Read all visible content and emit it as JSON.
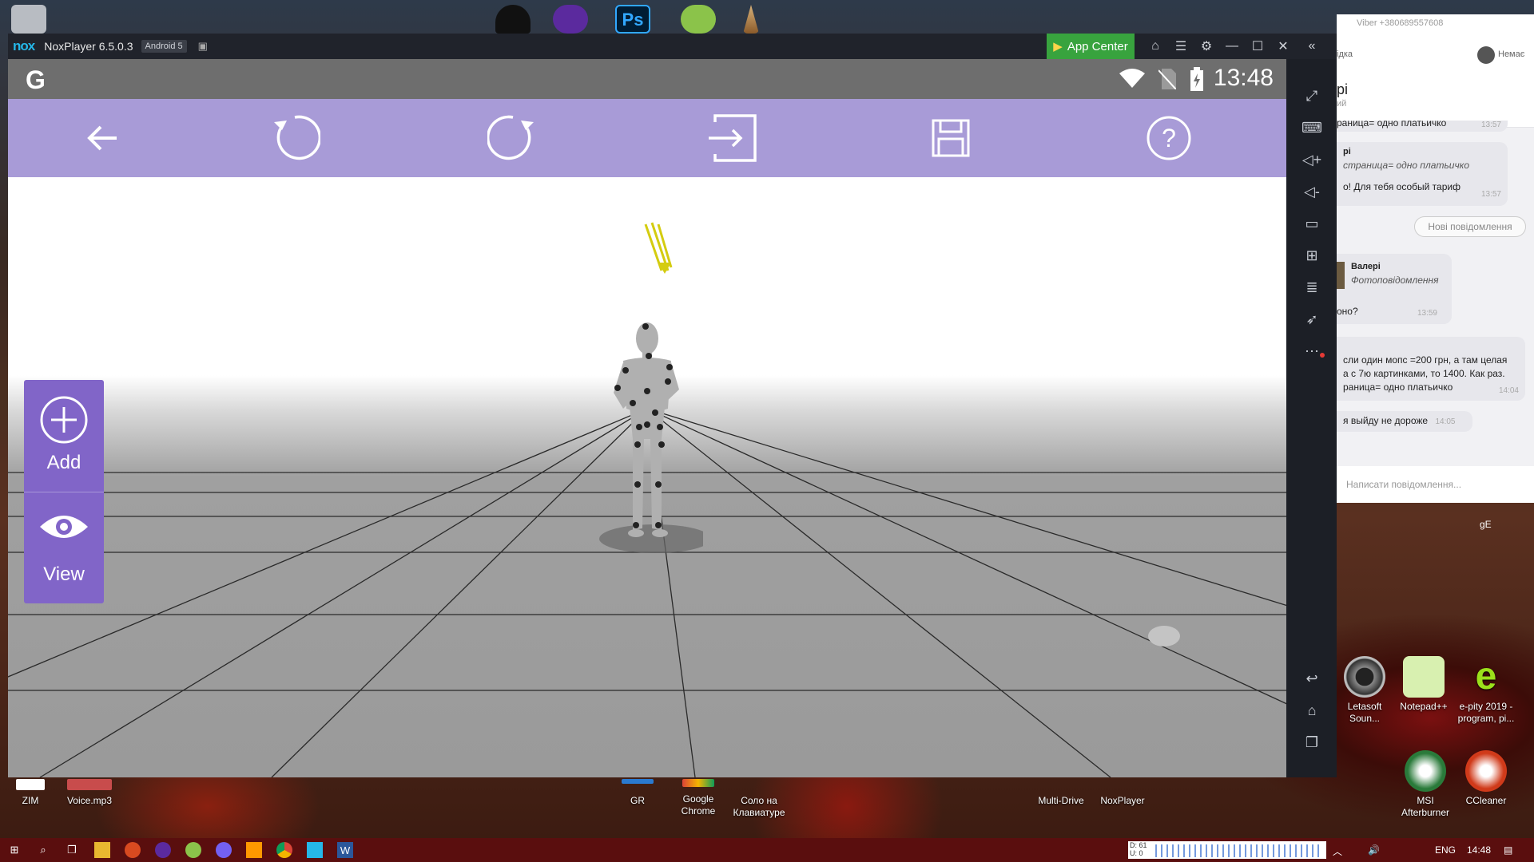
{
  "desktop": {
    "top_icons": [
      "trash-icon",
      "inkscape-icon",
      "tor-icon",
      "photoshop-icon",
      "lime-icon",
      "pencil-icon"
    ],
    "icons": [
      {
        "name": "desktop-icon-zim",
        "label": "ZIM"
      },
      {
        "name": "desktop-icon-voice",
        "label": "Voice.mp3"
      },
      {
        "name": "desktop-icon-gr",
        "label": "GR"
      },
      {
        "name": "desktop-icon-chrome",
        "label": "Google Chrome"
      },
      {
        "name": "desktop-icon-keyboard-solo",
        "label": "Соло на Клавиатуре"
      },
      {
        "name": "desktop-icon-multidrive",
        "label": "Multi-Drive"
      },
      {
        "name": "desktop-icon-noxplayer",
        "label": "NoxPlayer"
      },
      {
        "name": "desktop-icon-letasoft",
        "label": "Letasoft Soun..."
      },
      {
        "name": "desktop-icon-notepadpp",
        "label": "Notepad++"
      },
      {
        "name": "desktop-icon-epity",
        "label": "e-pity 2019 - program, pi..."
      },
      {
        "name": "desktop-icon-msi",
        "label": "MSI Afterburner"
      },
      {
        "name": "desktop-icon-ccleaner",
        "label": "CCleaner"
      }
    ],
    "side_text": "gE"
  },
  "nox": {
    "title": "NoxPlayer 6.5.0.3",
    "android": "Android 5",
    "app_center": "App Center",
    "status": {
      "g": "G",
      "time": "13:48"
    },
    "toolbar": [
      "back-arrow-icon",
      "undo-icon",
      "redo-icon",
      "import-icon",
      "save-icon",
      "help-icon"
    ],
    "side": {
      "add": "Add",
      "view": "View"
    },
    "colors": {
      "toolbar": "#a89bd7",
      "panel": "#8165c8",
      "appcenter": "#38a33e"
    }
  },
  "viber": {
    "top": "Viber +380689557608",
    "header_right": "Немає",
    "header_left": "ідка",
    "chat_name": "рі",
    "chat_sub": "ий",
    "messages": [
      {
        "text": "раница= одно платьичко",
        "time": "13:57"
      },
      {
        "quote_name": "рі",
        "quote": "страница= одно платьичко"
      },
      {
        "text": "о! Для тебя особый тариф",
        "time": "13:57"
      },
      {
        "system": "Нові повідомлення"
      },
      {
        "sender": "Валері",
        "sub": "Фотоповідомлення"
      },
      {
        "text": "оно?",
        "time": "13:59"
      },
      {
        "text": "сли один мопс =200 грн, а там целая\nа с 7ю картинками, то 1400. Как раз.\nраница= одно платьичко",
        "time": "14:04"
      },
      {
        "text": "я выйду не дороже",
        "time": "14:05"
      }
    ],
    "input_placeholder": "Написати повідомлення..."
  },
  "taskbar": {
    "lang": "ENG",
    "time": "14:48",
    "net_d": "D: 61",
    "net_u": "U: 0"
  }
}
